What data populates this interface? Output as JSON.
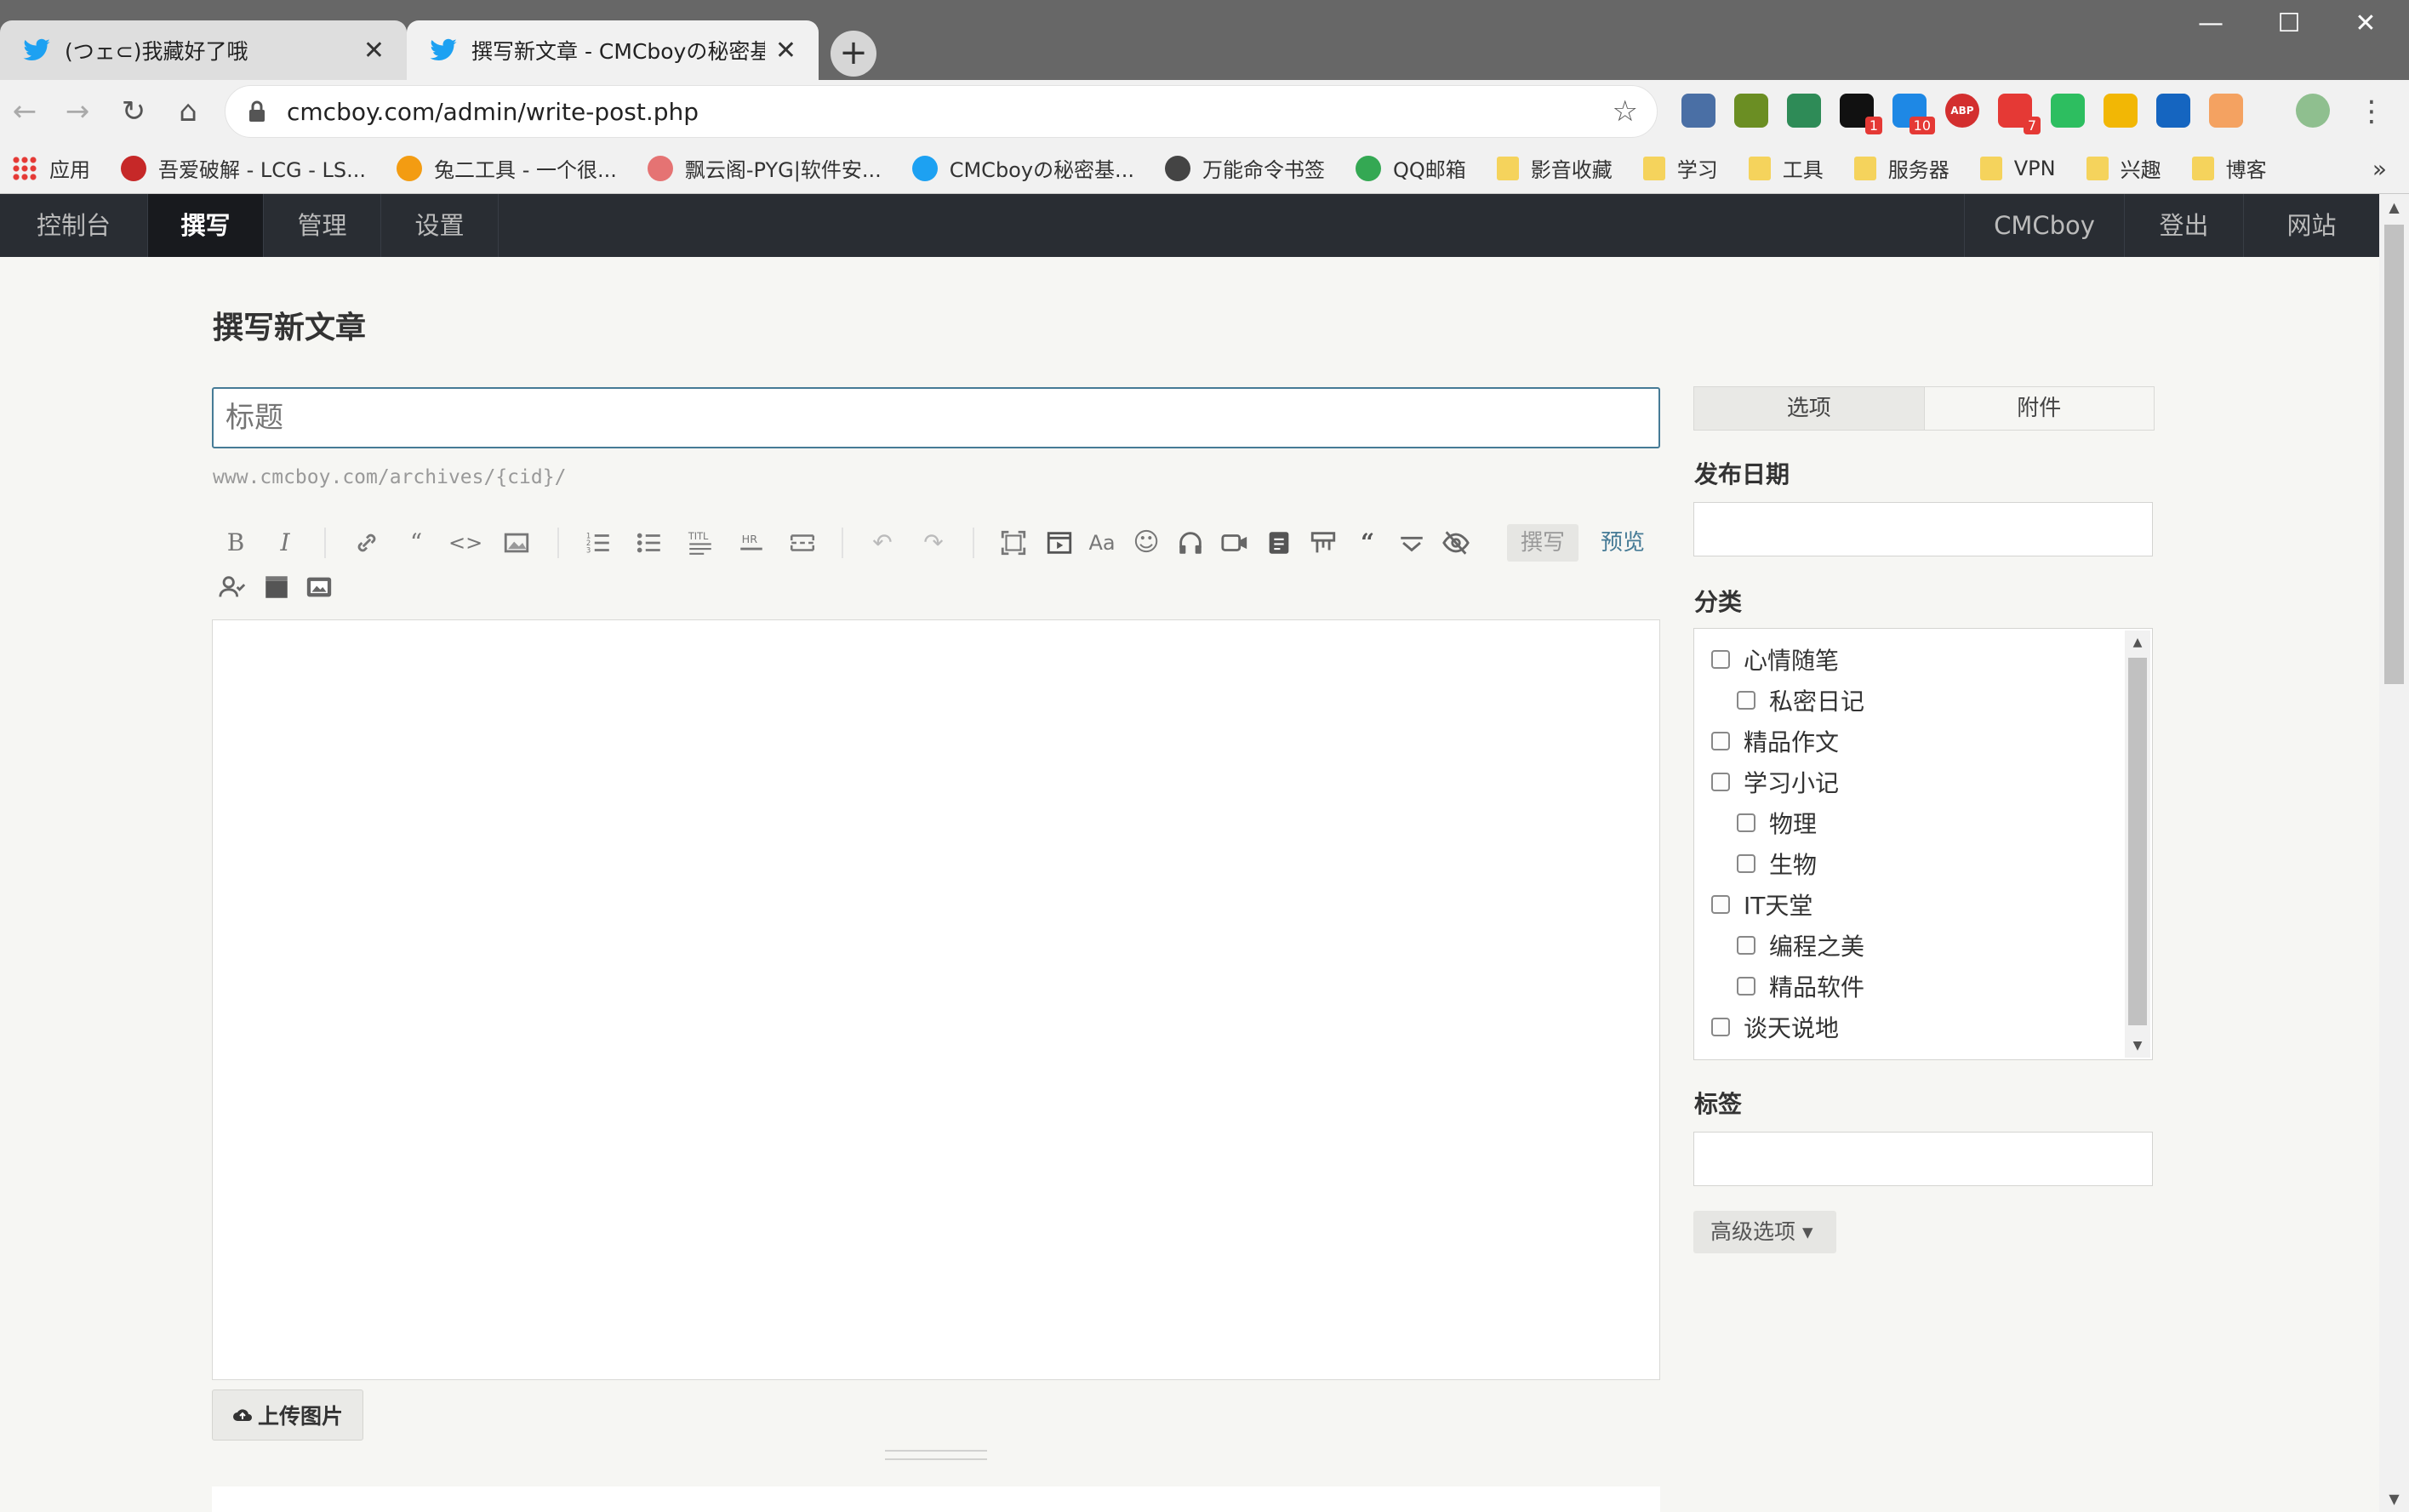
{
  "browser": {
    "tabs": [
      {
        "label": "(つェ⊂)我藏好了哦",
        "close": "✕"
      },
      {
        "label": "撰写新文章 - CMCboyの秘密基地",
        "close": "✕"
      }
    ],
    "new_tab": "+",
    "window_controls": {
      "minimize": "—",
      "maximize": "☐",
      "close": "✕"
    },
    "url": "cmcboy.com/admin/write-post.php",
    "extensions": [
      {
        "name": "ext-1",
        "color": "#4a6fa5"
      },
      {
        "name": "ext-2",
        "color": "#6b8e23"
      },
      {
        "name": "ext-3",
        "color": "#2e8b57"
      },
      {
        "name": "ext-4",
        "color": "#111111",
        "badge": "1"
      },
      {
        "name": "ext-5",
        "color": "#1e88e5",
        "badge": "10"
      },
      {
        "name": "abp",
        "color": "#d32f2f",
        "label": "ABP"
      },
      {
        "name": "ext-7",
        "color": "#e53935",
        "badge": "7"
      },
      {
        "name": "evernote",
        "color": "#2dbe60"
      },
      {
        "name": "ext-9",
        "color": "#f2b705"
      },
      {
        "name": "ext-10",
        "color": "#1565c0"
      },
      {
        "name": "ext-11",
        "color": "#f4a261"
      }
    ],
    "bookmarks": [
      {
        "label": "应用",
        "icon": "apps-grid-icon",
        "color": "#e53935"
      },
      {
        "label": "吾爱破解 - LCG - LS...",
        "icon": "site-icon",
        "color": "#c62828"
      },
      {
        "label": "兔二工具 - 一个很...",
        "icon": "pinwheel-icon",
        "color": "#f39c12"
      },
      {
        "label": "飘云阁-PYG|软件安...",
        "icon": "shield-icon",
        "color": "#e57373"
      },
      {
        "label": "CMCboyの秘密基...",
        "icon": "bird-icon",
        "color": "#1da1f2"
      },
      {
        "label": "万能命令书签",
        "icon": "globe-icon",
        "color": "#444444"
      },
      {
        "label": "QQ邮箱",
        "icon": "chrome-icon",
        "color": "#34a853"
      },
      {
        "label": "影音收藏",
        "icon": "folder-icon",
        "color": "#f5d35c"
      },
      {
        "label": "学习",
        "icon": "folder-icon",
        "color": "#f5d35c"
      },
      {
        "label": "工具",
        "icon": "folder-icon",
        "color": "#f5d35c"
      },
      {
        "label": "服务器",
        "icon": "folder-icon",
        "color": "#f5d35c"
      },
      {
        "label": "VPN",
        "icon": "folder-icon",
        "color": "#f5d35c"
      },
      {
        "label": "兴趣",
        "icon": "folder-icon",
        "color": "#f5d35c"
      },
      {
        "label": "博客",
        "icon": "folder-icon",
        "color": "#f5d35c"
      }
    ],
    "bookmarks_more": "»"
  },
  "admin_nav": {
    "left": [
      "控制台",
      "撰写",
      "管理",
      "设置"
    ],
    "active": "撰写",
    "right": [
      "CMCboy",
      "登出",
      "网站"
    ]
  },
  "page": {
    "title": "撰写新文章",
    "title_placeholder": "标题",
    "slug": "www.cmcboy.com/archives/{cid}/",
    "mode_write": "撰写",
    "mode_preview": "预览",
    "upload_button": "上传图片"
  },
  "sidebar": {
    "tabs": [
      "选项",
      "附件"
    ],
    "publish_date_label": "发布日期",
    "category_label": "分类",
    "categories": [
      {
        "label": "心情随笔",
        "level": 0
      },
      {
        "label": "私密日记",
        "level": 1
      },
      {
        "label": "精品作文",
        "level": 0
      },
      {
        "label": "学习小记",
        "level": 0
      },
      {
        "label": "物理",
        "level": 1
      },
      {
        "label": "生物",
        "level": 1
      },
      {
        "label": "IT天堂",
        "level": 0
      },
      {
        "label": "编程之美",
        "level": 1
      },
      {
        "label": "精品软件",
        "level": 1
      },
      {
        "label": "谈天说地",
        "level": 0
      }
    ],
    "tags_label": "标签",
    "advanced_button": "高级选项 ▾"
  },
  "colors": {
    "accent": "#467b96",
    "admin_bar": "#292d33",
    "page_bg": "#f6f6f3"
  }
}
